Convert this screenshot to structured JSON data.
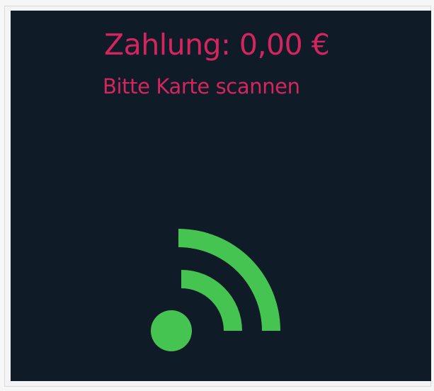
{
  "payment": {
    "title": "Zahlung: 0,00 €",
    "prompt": "Bitte Karte scannen"
  },
  "icon": {
    "name": "contactless-scan-icon",
    "color": "#46c452"
  },
  "colors": {
    "background": "#0f1c28",
    "text": "#d6245f"
  }
}
